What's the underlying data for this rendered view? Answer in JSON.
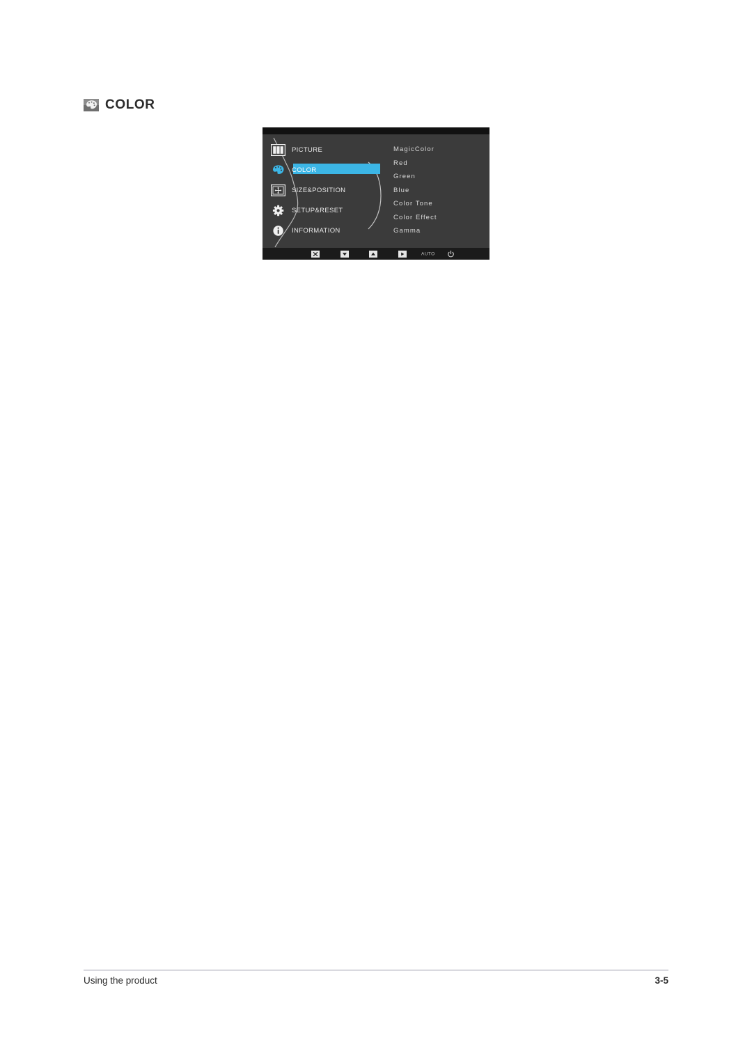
{
  "page": {
    "heading": "COLOR",
    "heading_icon": "color-palette-icon",
    "background": "#ffffff"
  },
  "osd": {
    "highlight_color": "#3cb6e6",
    "body_color": "#3b3b3b",
    "topbar_color": "#111111",
    "bottombar_color": "#1b1b1b",
    "left_menu": [
      {
        "label": "PICTURE",
        "icon": "picture-bars-icon",
        "selected": false
      },
      {
        "label": "COLOR",
        "icon": "color-palette-icon",
        "selected": true
      },
      {
        "label": "SIZE&POSITION",
        "icon": "size-position-icon",
        "selected": false
      },
      {
        "label": "SETUP&RESET",
        "icon": "gear-icon",
        "selected": false
      },
      {
        "label": "INFORMATION",
        "icon": "info-circle-icon",
        "selected": false
      }
    ],
    "sub_menu": [
      {
        "label": "MagicColor"
      },
      {
        "label": "Red"
      },
      {
        "label": "Green"
      },
      {
        "label": "Blue"
      },
      {
        "label": "Color Tone"
      },
      {
        "label": "Color Effect"
      },
      {
        "label": "Gamma"
      }
    ],
    "bottom_bar": [
      {
        "name": "exit-button",
        "icon": "close-x-box-icon",
        "label": ""
      },
      {
        "name": "down-button",
        "icon": "down-triangle-icon",
        "label": ""
      },
      {
        "name": "up-button",
        "icon": "up-triangle-icon",
        "label": ""
      },
      {
        "name": "enter-button",
        "icon": "play-arrow-icon",
        "label": ""
      },
      {
        "name": "auto-button",
        "icon": "auto-text",
        "label": "AUTO"
      },
      {
        "name": "power-button",
        "icon": "power-icon",
        "label": ""
      }
    ]
  },
  "footer": {
    "left": "Using the product",
    "right": "3-5"
  }
}
